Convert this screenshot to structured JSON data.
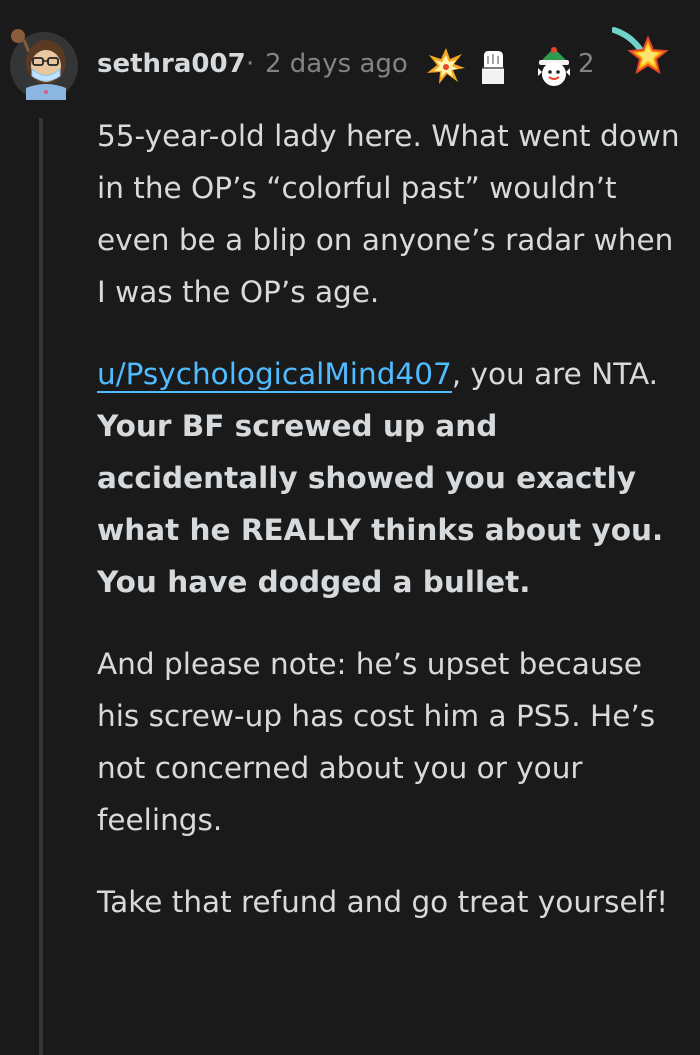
{
  "comment": {
    "author": "sethra007",
    "separator": "·",
    "timestamp": "2 days ago",
    "award_count": "2",
    "paragraphs": {
      "p1": "55-year-old lady here. What went down in the OP’s “colorful past” wouldn’t even be a blip on anyone’s radar when I was the OP’s age.",
      "p2_link": "u/PsychologicalMind407",
      "p2_text": ", you are NTA. ",
      "p2_bold": "Your BF screwed up and accidentally showed you exactly what he REALLY thinks about you. You have dodged a bullet.",
      "p3": "And please note: he’s upset because his screw-up has cost him a PS5. He’s not concerned about you or your feelings.",
      "p4": "Take that refund and go treat yourself!"
    }
  },
  "awards": [
    "burst-award-icon",
    "fist-award-icon",
    "elf-award-icon",
    "star-award-icon"
  ],
  "colors": {
    "background": "#1a1a1b",
    "text": "#d7dadc",
    "muted": "#818384",
    "link": "#4fbcff",
    "thread_line": "#343536"
  }
}
